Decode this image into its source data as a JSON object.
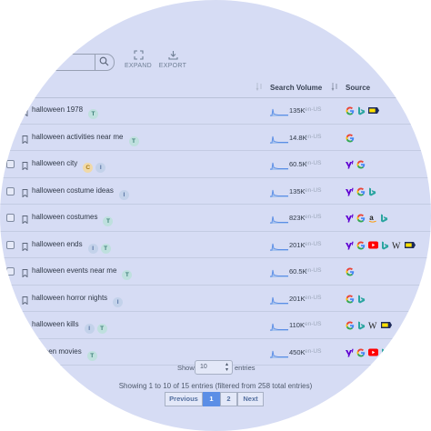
{
  "toolbar": {
    "expand_label": "EXPAND",
    "export_label": "EXPORT"
  },
  "table": {
    "headers": {
      "keyword": "d",
      "volume": "Search Volume",
      "source": "Source"
    },
    "rows": [
      {
        "keyword": "halloween 1978",
        "badges": [
          "T"
        ],
        "volume": "135K",
        "locale": "en-US",
        "sources": [
          "google",
          "bing",
          "bestbuy"
        ],
        "checkbox": false
      },
      {
        "keyword": "halloween activities near me",
        "badges": [
          "T"
        ],
        "volume": "14.8K",
        "locale": "en-US",
        "sources": [
          "google"
        ],
        "checkbox": false
      },
      {
        "keyword": "halloween city",
        "badges": [
          "C",
          "I"
        ],
        "volume": "60.5K",
        "locale": "en-US",
        "sources": [
          "yahoo",
          "google"
        ],
        "checkbox": true
      },
      {
        "keyword": "halloween costume ideas",
        "badges": [
          "I"
        ],
        "volume": "135K",
        "locale": "en-US",
        "sources": [
          "yahoo",
          "google",
          "bing"
        ],
        "checkbox": true
      },
      {
        "keyword": "halloween costumes",
        "badges": [
          "T"
        ],
        "volume": "823K",
        "locale": "en-US",
        "sources": [
          "yahoo",
          "google",
          "amazon",
          "bing"
        ],
        "checkbox": true
      },
      {
        "keyword": "halloween ends",
        "badges": [
          "I",
          "T"
        ],
        "volume": "201K",
        "locale": "en-US",
        "sources": [
          "yahoo",
          "google",
          "youtube",
          "bing",
          "wikipedia",
          "bestbuy"
        ],
        "checkbox": true
      },
      {
        "keyword": "halloween events near me",
        "badges": [
          "T"
        ],
        "volume": "60.5K",
        "locale": "en-US",
        "sources": [
          "google"
        ],
        "checkbox": true
      },
      {
        "keyword": "halloween horror nights",
        "badges": [
          "I"
        ],
        "volume": "201K",
        "locale": "en-US",
        "sources": [
          "google",
          "bing"
        ],
        "checkbox": true
      },
      {
        "keyword": "halloween kills",
        "badges": [
          "I",
          "T"
        ],
        "volume": "110K",
        "locale": "en-US",
        "sources": [
          "google",
          "bing",
          "wikipedia",
          "bestbuy"
        ],
        "checkbox": true
      },
      {
        "keyword": "lloween movies",
        "badges": [
          "T"
        ],
        "volume": "450K",
        "locale": "en-US",
        "sources": [
          "yahoo",
          "google",
          "youtube",
          "bing"
        ],
        "checkbox": false
      }
    ]
  },
  "footer": {
    "show_label": "Show",
    "page_size": "10",
    "entries_suffix": "entries",
    "summary": "Showing 1 to 10 of 15 entries (filtered from 258 total entries)",
    "previous_label": "Previous",
    "pages": [
      "1",
      "2"
    ],
    "next_label": "Next"
  },
  "colors": {
    "background": "#d6dcf4",
    "accent": "#5b8ee6",
    "text": "#2f3847"
  }
}
